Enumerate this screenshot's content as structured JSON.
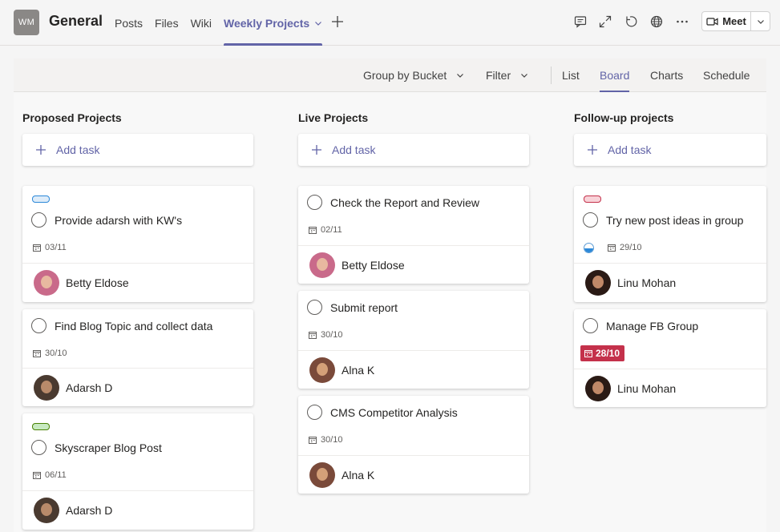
{
  "header": {
    "avatar_initials": "WM",
    "channel_title": "General",
    "tabs": [
      {
        "label": "Posts"
      },
      {
        "label": "Files"
      },
      {
        "label": "Wiki"
      },
      {
        "label": "Weekly Projects"
      }
    ],
    "meet_label": "Meet",
    "icons": [
      "chat-icon",
      "expand-icon",
      "refresh-icon",
      "globe-icon",
      "more-icon",
      "video-camera-icon"
    ]
  },
  "toolbar": {
    "group_by": "Group by Bucket",
    "filter": "Filter",
    "views": [
      "List",
      "Board",
      "Charts",
      "Schedule"
    ],
    "active_view": "Board"
  },
  "add_task_label": "Add task",
  "colors": {
    "accent": "#6264a7",
    "overdue": "#c4314b",
    "label_blue": "#deecf9",
    "label_green": "#c7e9c0",
    "label_pink": "#f8d2d8"
  },
  "buckets": [
    {
      "title": "Proposed Projects",
      "cards": [
        {
          "title": "Provide adarsh with KW's",
          "due": "03/11",
          "assignee": "Betty Eldose"
        },
        {
          "title": "Find Blog Topic and collect data",
          "due": "30/10",
          "assignee": "Adarsh D"
        },
        {
          "title": "Skyscraper Blog Post",
          "due": "06/11",
          "assignee": "Adarsh D"
        }
      ]
    },
    {
      "title": "Live Projects",
      "cards": [
        {
          "title": "Check the Report and Review",
          "due": "02/11",
          "assignee": "Betty Eldose"
        },
        {
          "title": "Submit report",
          "due": "30/10",
          "assignee": "Alna K"
        },
        {
          "title": "CMS Competitor Analysis",
          "due": "30/10",
          "assignee": "Alna K"
        }
      ]
    },
    {
      "title": "Follow-up projects",
      "cards": [
        {
          "title": "Try new post ideas in group",
          "due": "29/10",
          "progress": 0.5,
          "assignee": "Linu Mohan"
        },
        {
          "title": "Manage FB Group",
          "due": "28/10",
          "due_status": "overdue",
          "assignee": "Linu Mohan"
        }
      ]
    }
  ]
}
